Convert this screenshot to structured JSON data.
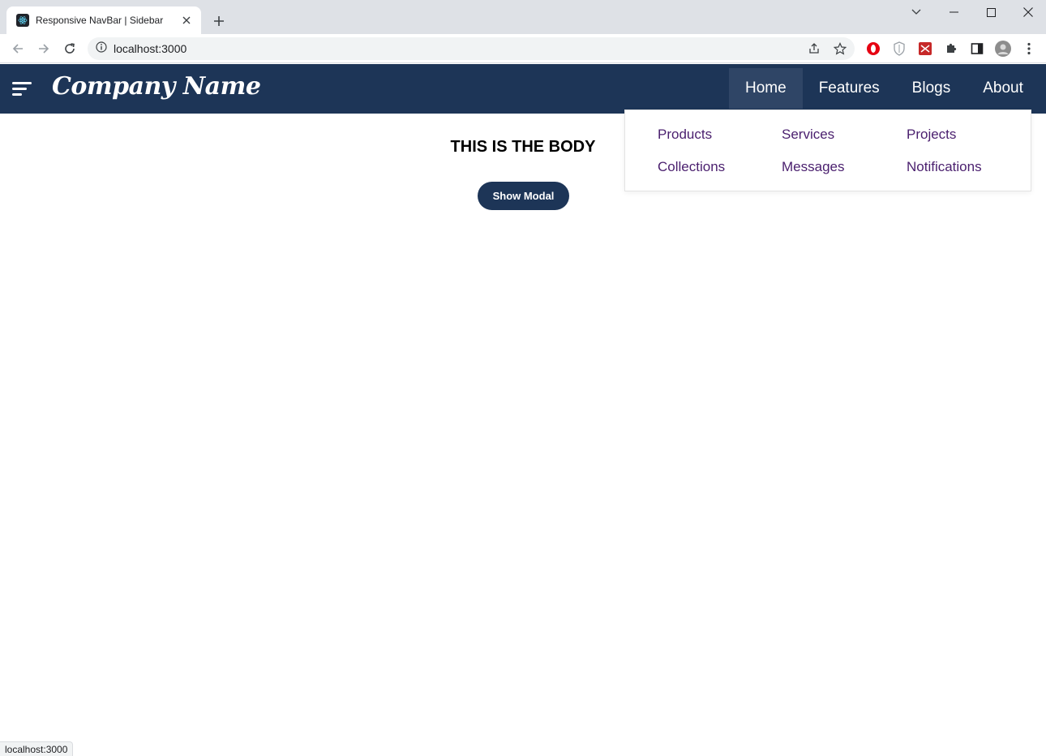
{
  "browser": {
    "tab_title": "Responsive NavBar | Sidebar",
    "url": "localhost:3000",
    "status_url": "localhost:3000"
  },
  "icons": {
    "favicon": "react-logo-icon",
    "tab_close": "close-icon",
    "new_tab": "plus-icon",
    "tab_search": "chevron-down-icon",
    "minimize": "minimize-icon",
    "maximize": "maximize-icon",
    "window_close": "close-icon",
    "back": "arrow-left-icon",
    "forward": "arrow-right-icon",
    "reload": "reload-icon",
    "site_info": "info-icon",
    "share": "share-icon",
    "bookmark": "star-icon",
    "extensions": [
      "opera-icon",
      "shield-icon",
      "extension-red-icon",
      "puzzle-icon"
    ],
    "side_panel": "side-panel-icon",
    "profile": "avatar",
    "menu": "kebab-menu-icon",
    "hamburger": "hamburger-icon"
  },
  "navbar": {
    "brand": "Company Name",
    "items": [
      {
        "label": "Home",
        "active": true
      },
      {
        "label": "Features",
        "active": false
      },
      {
        "label": "Blogs",
        "active": false
      },
      {
        "label": "About",
        "active": false
      }
    ]
  },
  "dropdown": {
    "rows": [
      [
        "Products",
        "Services",
        "Projects"
      ],
      [
        "Collections",
        "Messages",
        "Notifications"
      ]
    ]
  },
  "body": {
    "title": "THIS IS THE BODY",
    "button_label": "Show Modal"
  },
  "colors": {
    "navbar_bg": "#1d3557",
    "navbar_active_bg": "#2f4566",
    "dropdown_link": "#4a1f6e",
    "button_bg": "#1d3557"
  }
}
